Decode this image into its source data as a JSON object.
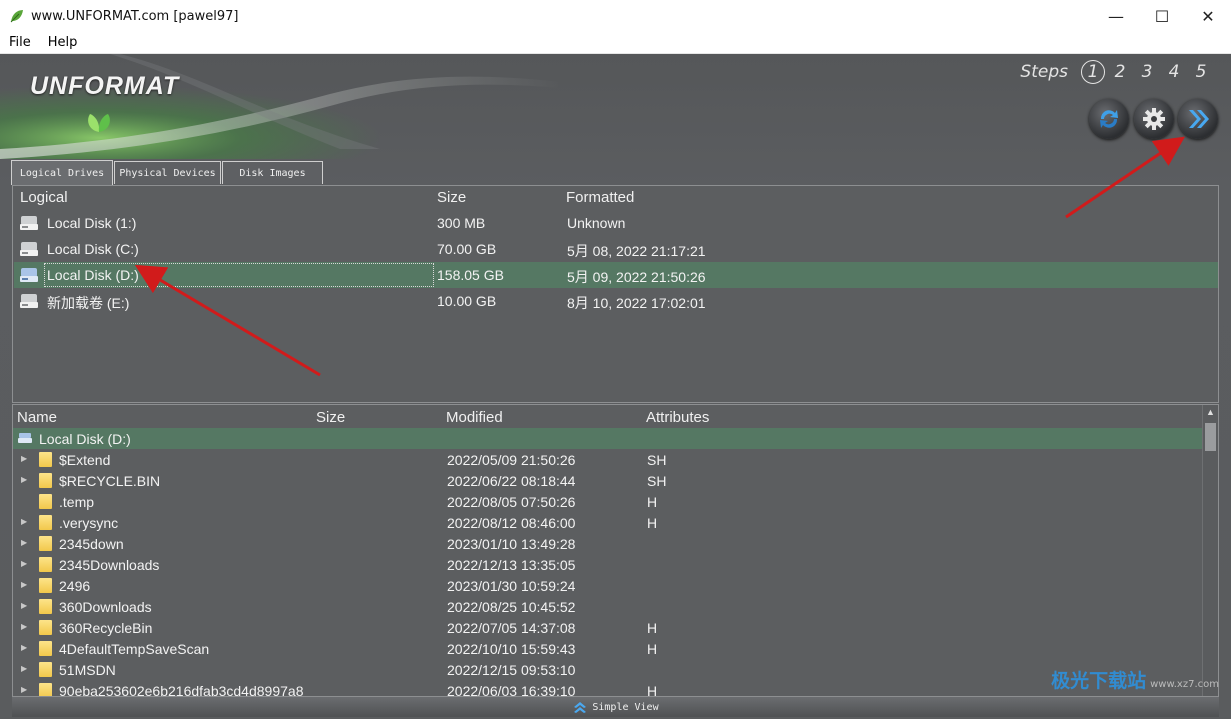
{
  "window": {
    "title": "www.UNFORMAT.com [pawel97]",
    "minimize_glyph": "—",
    "maximize_glyph": "☐",
    "close_glyph": "✕"
  },
  "menu": {
    "items": [
      "File",
      "Help"
    ]
  },
  "app": {
    "logo_text": "UNFORMAT",
    "steps_label": "Steps",
    "steps": [
      "1",
      "2",
      "3",
      "4",
      "5"
    ],
    "active_step": "1"
  },
  "tabs": [
    "Logical Drives",
    "Physical Devices",
    "Disk Images"
  ],
  "drives": {
    "headers": {
      "logical": "Logical",
      "size": "Size",
      "formatted": "Formatted"
    },
    "rows": [
      {
        "name": "Local Disk (1:)",
        "size": "300 MB",
        "formatted": "Unknown"
      },
      {
        "name": "Local Disk (C:)",
        "size": "70.00 GB",
        "formatted": "5月 08, 2022 21:17:21"
      },
      {
        "name": "Local Disk (D:)",
        "size": "158.05 GB",
        "formatted": "5月 09, 2022 21:50:26"
      },
      {
        "name": "新加载卷 (E:)",
        "size": "10.00 GB",
        "formatted": "8月 10, 2022 17:02:01"
      }
    ],
    "selected_index": 2
  },
  "files": {
    "headers": {
      "name": "Name",
      "size": "Size",
      "modified": "Modified",
      "attributes": "Attributes"
    },
    "root": "Local Disk (D:)",
    "rows": [
      {
        "name": "$Extend",
        "modified": "2022/05/09 21:50:26",
        "attr": "SH",
        "expandable": true
      },
      {
        "name": "$RECYCLE.BIN",
        "modified": "2022/06/22 08:18:44",
        "attr": "SH",
        "expandable": true
      },
      {
        "name": ".temp",
        "modified": "2022/08/05 07:50:26",
        "attr": "H",
        "expandable": false
      },
      {
        "name": ".verysync",
        "modified": "2022/08/12 08:46:00",
        "attr": "H",
        "expandable": true
      },
      {
        "name": "2345down",
        "modified": "2023/01/10 13:49:28",
        "attr": "",
        "expandable": true
      },
      {
        "name": "2345Downloads",
        "modified": "2022/12/13 13:35:05",
        "attr": "",
        "expandable": true
      },
      {
        "name": "2496",
        "modified": "2023/01/30 10:59:24",
        "attr": "",
        "expandable": true
      },
      {
        "name": "360Downloads",
        "modified": "2022/08/25 10:45:52",
        "attr": "",
        "expandable": true
      },
      {
        "name": "360RecycleBin",
        "modified": "2022/07/05 14:37:08",
        "attr": "H",
        "expandable": true
      },
      {
        "name": "4DefaultTempSaveScan",
        "modified": "2022/10/10 15:59:43",
        "attr": "H",
        "expandable": true
      },
      {
        "name": "51MSDN",
        "modified": "2022/12/15 09:53:10",
        "attr": "",
        "expandable": true
      },
      {
        "name": "90eba253602e6b216dfab3cd4d8997a8",
        "modified": "2022/06/03 16:39:10",
        "attr": "H",
        "expandable": true
      }
    ]
  },
  "statusbar": {
    "label": "Simple View"
  },
  "watermark": {
    "text": "极光下载站",
    "site": "www.xz7.com"
  },
  "colors": {
    "selection": "#557863",
    "annotation_arrow": "#d11b1b",
    "background": "#5a5c5e"
  },
  "icons": {
    "refresh": "refresh-icon",
    "settings": "gear-icon",
    "next": "double-chevron-right-icon"
  }
}
